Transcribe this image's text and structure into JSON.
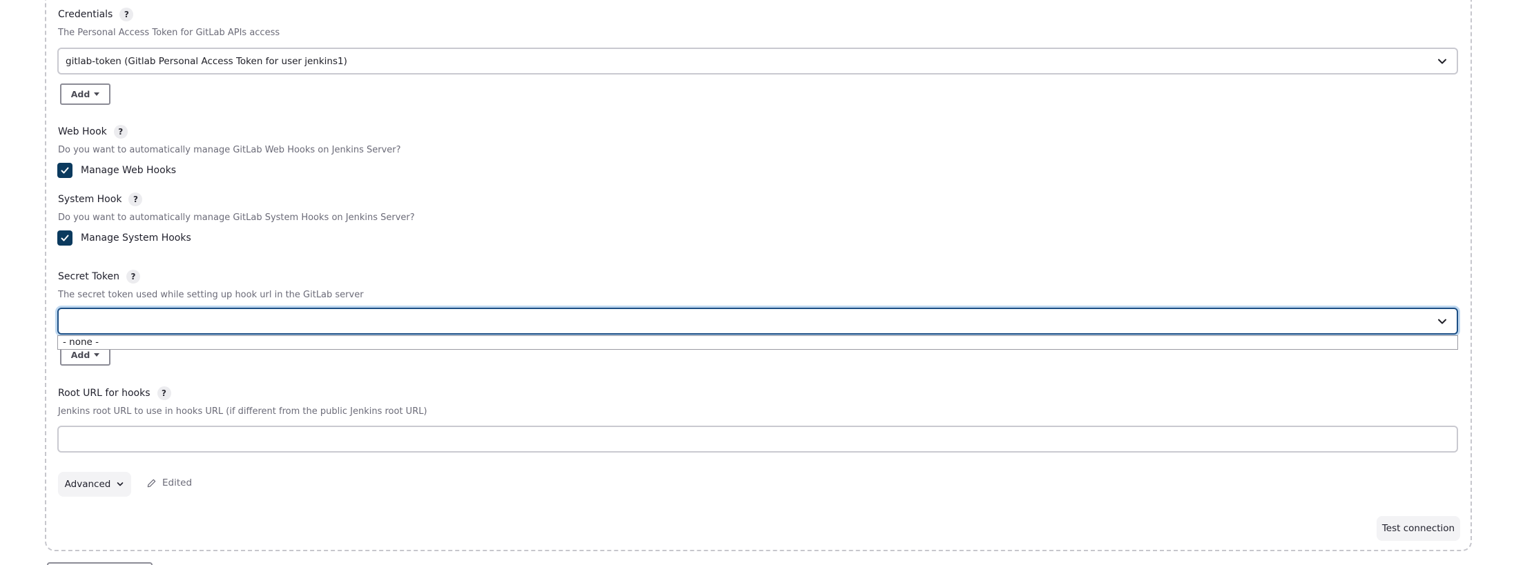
{
  "credentials": {
    "label": "Credentials",
    "help": "?",
    "description": "The Personal Access Token for GitLab APIs access",
    "selected": "gitlab-token (Gitlab Personal Access Token for user jenkins1)",
    "add_label": "Add"
  },
  "web_hook": {
    "label": "Web Hook",
    "help": "?",
    "description": "Do you want to automatically manage GitLab Web Hooks on Jenkins Server?",
    "checkbox_label": "Manage Web Hooks",
    "checked": true
  },
  "system_hook": {
    "label": "System Hook",
    "help": "?",
    "description": "Do you want to automatically manage GitLab System Hooks on Jenkins Server?",
    "checkbox_label": "Manage System Hooks",
    "checked": true
  },
  "secret_token": {
    "label": "Secret Token",
    "help": "?",
    "description": "The secret token used while setting up hook url in the GitLab server",
    "selected": "",
    "options": [
      "- none -"
    ],
    "add_label": "Add"
  },
  "root_url": {
    "label": "Root URL for hooks",
    "help": "?",
    "description": "Jenkins root URL to use in hooks URL (if different from the public Jenkins root URL)",
    "value": ""
  },
  "footer": {
    "advanced_label": "Advanced",
    "edited_label": "Edited",
    "test_connection_label": "Test connection"
  },
  "colors": {
    "checkbox_fill": "#0b3a5e",
    "focus_border": "#1d4f85"
  }
}
